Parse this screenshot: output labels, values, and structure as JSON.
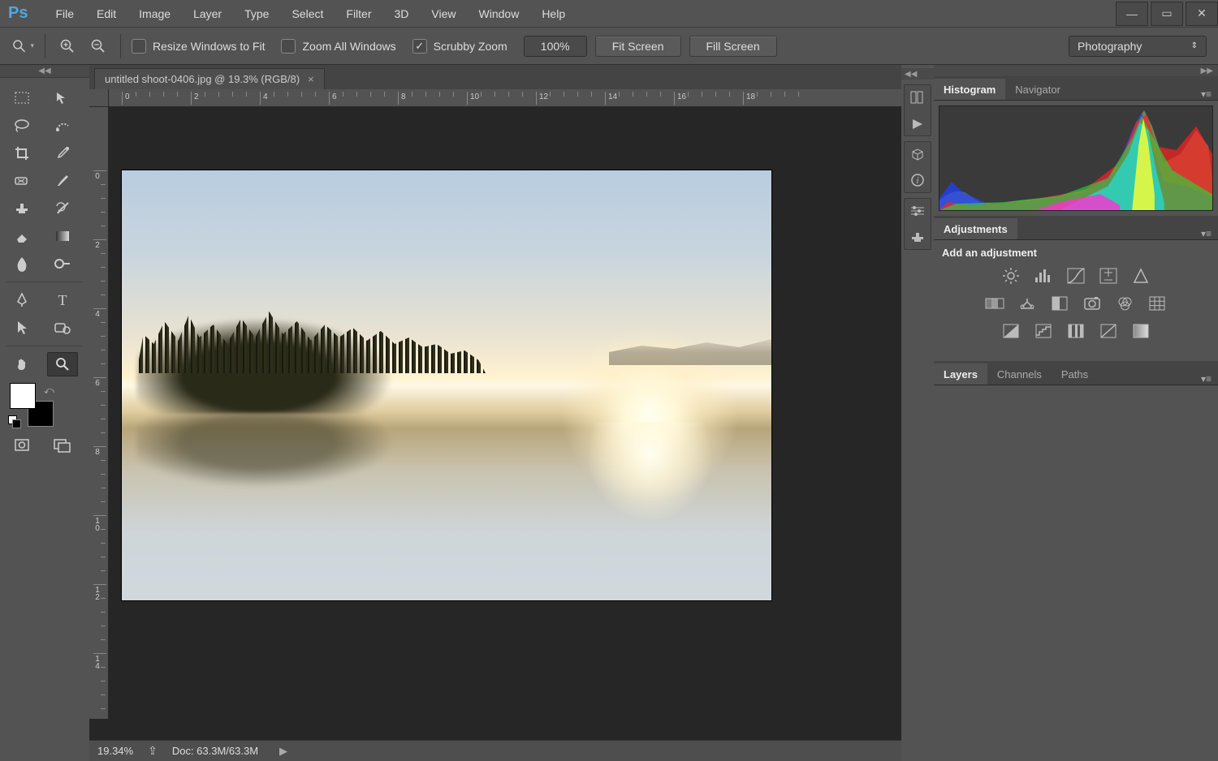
{
  "menu": {
    "items": [
      "File",
      "Edit",
      "Image",
      "Layer",
      "Type",
      "Select",
      "Filter",
      "3D",
      "View",
      "Window",
      "Help"
    ]
  },
  "options": {
    "resize_windows": "Resize Windows to Fit",
    "zoom_all": "Zoom All Windows",
    "scrubby_zoom": "Scrubby Zoom",
    "zoom_value": "100%",
    "fit_screen": "Fit Screen",
    "fill_screen": "Fill Screen",
    "workspace": "Photography"
  },
  "document": {
    "tab_title": "untitled shoot-0406.jpg @ 19.3% (RGB/8)",
    "status_zoom": "19.34%",
    "status_doc": "Doc: 63.3M/63.3M",
    "ruler_h": [
      "0",
      "2",
      "4",
      "6",
      "8",
      "10",
      "12",
      "14",
      "16",
      "18"
    ],
    "ruler_v": [
      "0",
      "2",
      "4",
      "6",
      "8",
      "10",
      "12",
      "14"
    ]
  },
  "panels": {
    "histogram": {
      "tab": "Histogram",
      "navigator": "Navigator"
    },
    "adjustments": {
      "title": "Adjustments",
      "add_label": "Add an adjustment",
      "row1": [
        "brightness-contrast",
        "levels",
        "curves",
        "exposure",
        "vibrance"
      ],
      "row2": [
        "hue-sat",
        "color-balance",
        "black-white",
        "photo-filter",
        "channel-mixer",
        "color-lookup"
      ],
      "row3": [
        "invert",
        "posterize",
        "threshold",
        "gradient-map",
        "selective-color"
      ]
    },
    "layers": {
      "tab": "Layers",
      "channels": "Channels",
      "paths": "Paths"
    }
  },
  "tools": [
    "marquee",
    "move",
    "lasso",
    "quick-select",
    "crop",
    "eyedropper",
    "spot-heal",
    "brush",
    "clone",
    "history-brush",
    "eraser",
    "gradient",
    "blur",
    "dodge",
    "pen",
    "type",
    "path-select",
    "shape",
    "hand",
    "zoom"
  ]
}
